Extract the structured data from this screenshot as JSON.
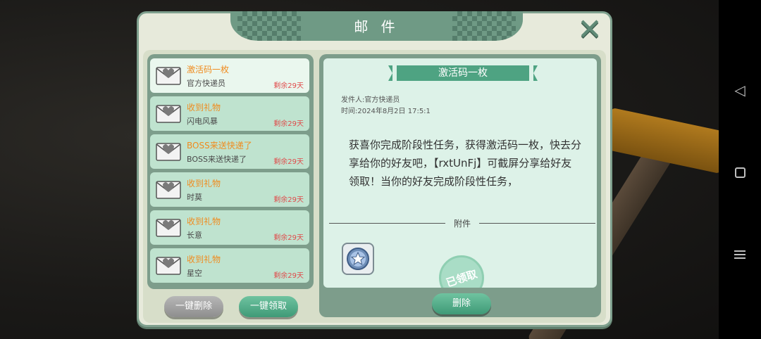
{
  "dialog": {
    "title": "邮 件",
    "close_icon": "close-icon"
  },
  "mail_list": [
    {
      "title": "激活码一枚",
      "sender": "官方快递员",
      "remaining": "剩余29天",
      "selected": true
    },
    {
      "title": "收到礼物",
      "sender": "闪电风暴",
      "remaining": "剩余29天",
      "selected": false
    },
    {
      "title": "BOSS来送快递了",
      "sender": "BOSS来送快递了",
      "remaining": "剩余29天",
      "selected": false
    },
    {
      "title": "收到礼物",
      "sender": "时莫",
      "remaining": "剩余29天",
      "selected": false
    },
    {
      "title": "收到礼物",
      "sender": "长意",
      "remaining": "剩余29天",
      "selected": false
    },
    {
      "title": "收到礼物",
      "sender": "星空",
      "remaining": "剩余29天",
      "selected": false
    }
  ],
  "buttons": {
    "delete_all": "一键删除",
    "claim_all": "一键领取",
    "delete": "删除"
  },
  "detail": {
    "title": "激活码一枚",
    "sender_line": "发件人:官方快递员",
    "time_line": "时间:2024年8月2日 17:5:1",
    "body": "获喜你完成阶段性任务，获得激活码一枚，快去分享给你的好友吧，【rxtUnFj】可截屏分享给好友领取！当你的好友完成阶段性任务，",
    "attachment_label": "附件",
    "claimed_stamp": "已领取",
    "attachment_icon": "blue-star-badge-icon"
  },
  "colors": {
    "accent_green": "#4ea382",
    "title_orange": "#f08b1e",
    "remaining_red": "#e04a4a",
    "panel_green": "#7d9d8b"
  }
}
